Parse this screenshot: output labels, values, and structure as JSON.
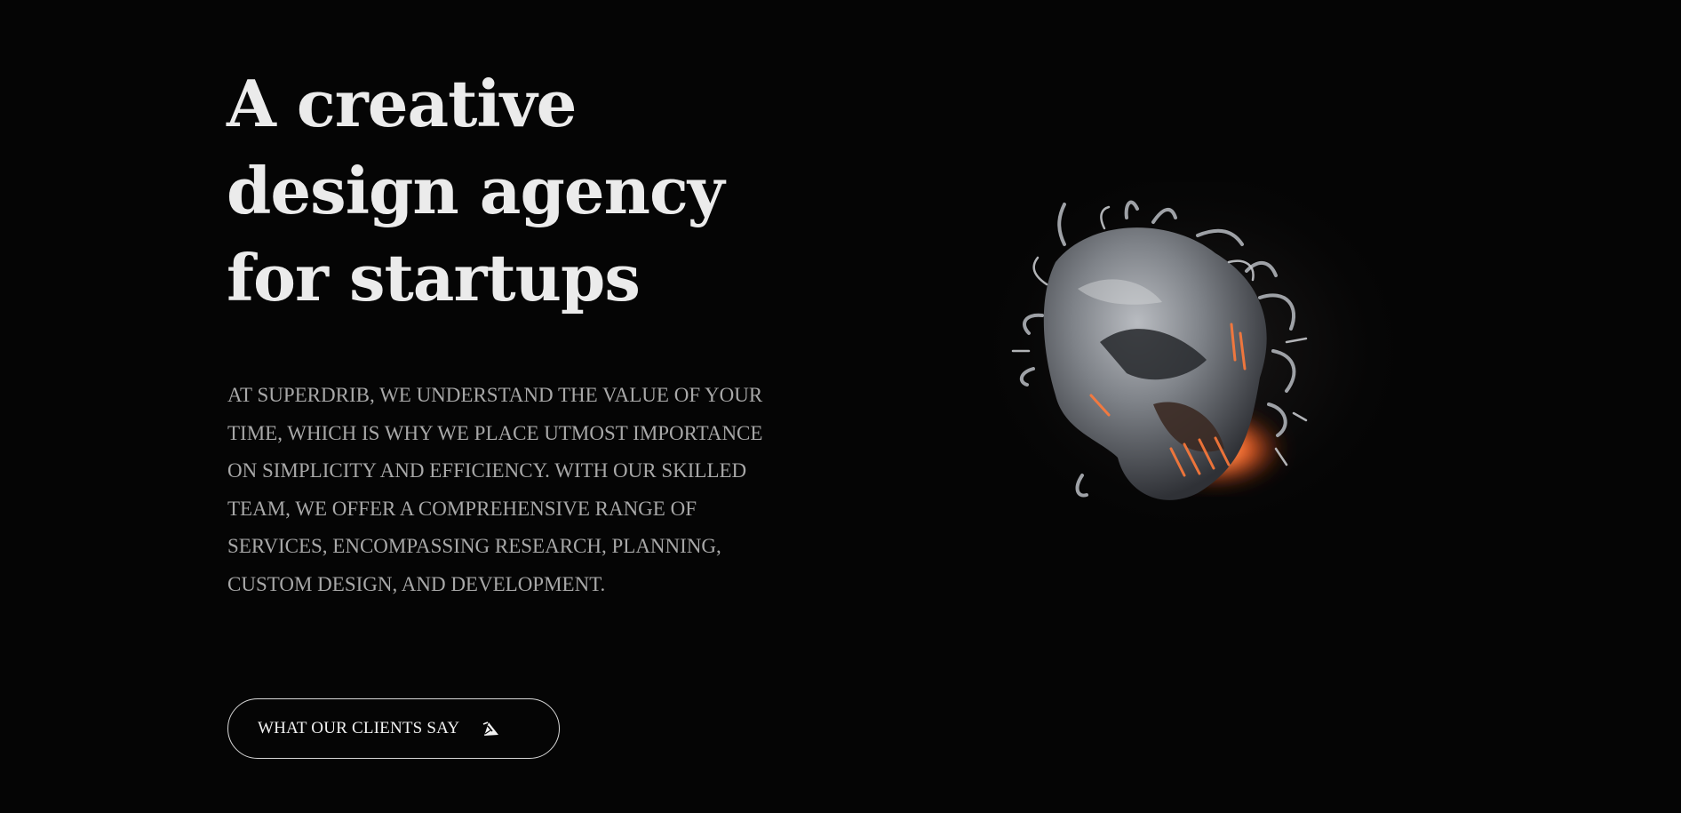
{
  "hero": {
    "title_lines": [
      "A creative",
      "design agency",
      "for startups"
    ],
    "description": "At Superdrib, we understand the value of your time, which is why we place utmost importance on simplicity and efficiency. With our skilled team, we offer a comprehensive range of services, encompassing research, planning, custom design, and development."
  },
  "cta": {
    "label": "WHAT OUR CLIENTS SAY",
    "icon": "pen-nib-arrow-icon"
  },
  "visual": {
    "icon": "abstract-3d-sculpture",
    "colors": {
      "background": "#050505",
      "heading": "#ebebeb",
      "body_text": "#a8a8a8",
      "button_border": "#d8d8d8",
      "sculpture_gray": "#8a8d92",
      "sculpture_glow": "#ff6a2b"
    }
  }
}
